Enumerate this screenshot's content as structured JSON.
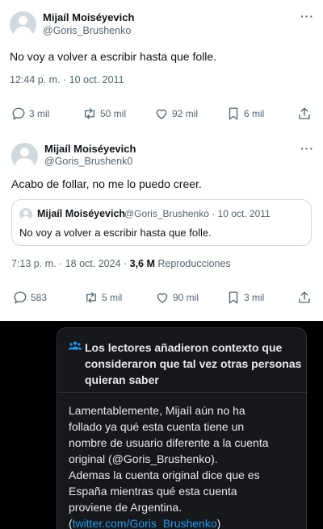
{
  "tweet1": {
    "name": "Mijaíl Moiséyevich",
    "handle": "@Goris_Brushenko",
    "text": "No voy a volver a escribir hasta que folle.",
    "timestamp": "12:44 p. m. · 10 oct. 2011",
    "actions": {
      "replies": "3 mil",
      "retweets": "50 mil",
      "likes": "92 mil",
      "bookmarks": "6 mil"
    }
  },
  "tweet2": {
    "name": "Mijaíl Moiséyevich",
    "handle": "@Goris_Brushenk0",
    "text": "Acabo de follar, no me lo puedo creer.",
    "quote": {
      "name": "Mijaíl Moiséyevich",
      "handle_date": "@Goris_Brushenko · 10 oct. 2011",
      "text": "No voy a volver a escribir hasta que folle."
    },
    "timestamp": "7:13 p. m. · 18 oct. 2024 ·",
    "views": "3,6 M",
    "views_label": "Reproducciones",
    "actions": {
      "replies": "583",
      "retweets": "5 mil",
      "likes": "90 mil",
      "bookmarks": "3 mil"
    }
  },
  "community_note": {
    "title": "Los lectores añadieron contexto que consideraron que tal vez otras personas quieran saber",
    "body_lines": [
      "Lamentablemente, Mijaíl aún no ha",
      "follado ya qué esta cuenta tiene un",
      "nombre de usuario diferente a la cuenta",
      "original (@Goris_Brushenko).",
      "Ademas la cuenta original dice que es",
      "España mientras qué esta cuenta",
      "proviene de Argentina."
    ],
    "link": "twitter.com/Goris_Brushenko",
    "link_open": "(",
    "link_close": ")"
  },
  "colors": {
    "link": "#1d9bf0",
    "note_bg": "#16181c",
    "muted": "#536471"
  },
  "icons": [
    "reply-icon",
    "retweet-icon",
    "like-icon",
    "bookmark-icon",
    "share-icon",
    "more-icon",
    "people-icon"
  ]
}
